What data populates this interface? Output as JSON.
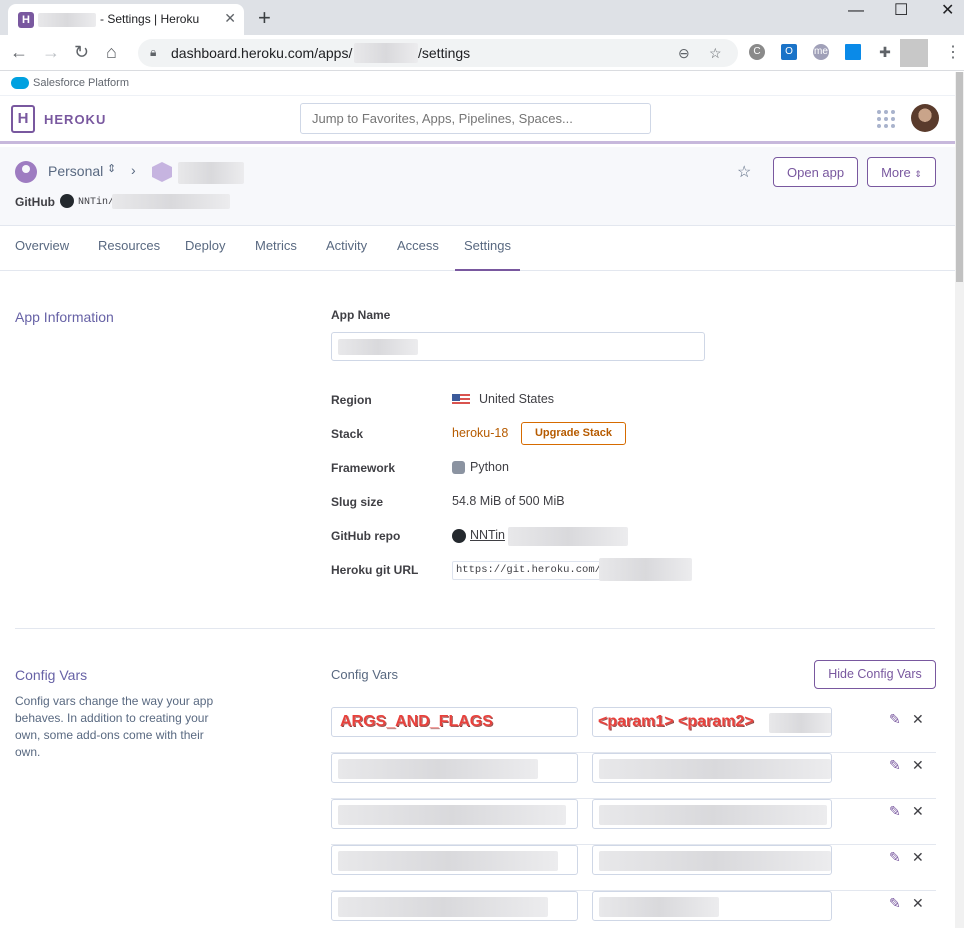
{
  "browser": {
    "tab_title": "- Settings | Heroku",
    "tab_close": "✕",
    "new_tab": "+",
    "url_prefix": "dashboard.heroku.com/apps/",
    "url_suffix": "/settings",
    "window_controls": [
      "—",
      "☐",
      "✕"
    ]
  },
  "salesforce_bar": {
    "label": "Salesforce Platform"
  },
  "header": {
    "logo_letter": "H",
    "brand": "HEROKU",
    "search_placeholder": "Jump to Favorites, Apps, Pipelines, Spaces..."
  },
  "app_header": {
    "account": "Personal",
    "github_label": "GitHub",
    "github_repo_prefix": "NNTin/",
    "open_app": "Open app",
    "more": "More",
    "more_chevron": "⌃⌄"
  },
  "tabs": [
    "Overview",
    "Resources",
    "Deploy",
    "Metrics",
    "Activity",
    "Access",
    "Settings"
  ],
  "active_tab": "Settings",
  "app_info": {
    "section_title": "App Information",
    "app_name_label": "App Name",
    "rows": [
      {
        "label": "Region",
        "value": "United States"
      },
      {
        "label": "Stack",
        "value": "heroku-18"
      },
      {
        "label": "Framework",
        "value": "Python"
      },
      {
        "label": "Slug size",
        "value": "54.8 MiB of 500 MiB"
      },
      {
        "label": "GitHub repo",
        "value": "NNTin"
      },
      {
        "label": "Heroku git URL",
        "value": "https://git.heroku.com/"
      }
    ],
    "upgrade_stack": "Upgrade Stack",
    "stack_color": "#b65b00"
  },
  "config_vars": {
    "section_title": "Config Vars",
    "description": "Config vars change the way your app behaves. In addition to creating your own, some add-ons come with their own.",
    "panel_title": "Config Vars",
    "hide_button": "Hide Config Vars",
    "first_key": "ARGS_AND_FLAGS",
    "first_value": "<param1> <param2>",
    "edit_icon": "✎",
    "delete_icon": "✕"
  },
  "colors": {
    "accent": "#79589f",
    "section_title": "#6762a6"
  },
  "icons": [
    "heroku-favicon",
    "lock-icon",
    "zoom-icon",
    "star-icon",
    "puzzle-icon",
    "apps-grid-icon",
    "person-icon",
    "github-icon",
    "flag-us-icon",
    "python-icon",
    "pencil-icon",
    "close-icon"
  ]
}
